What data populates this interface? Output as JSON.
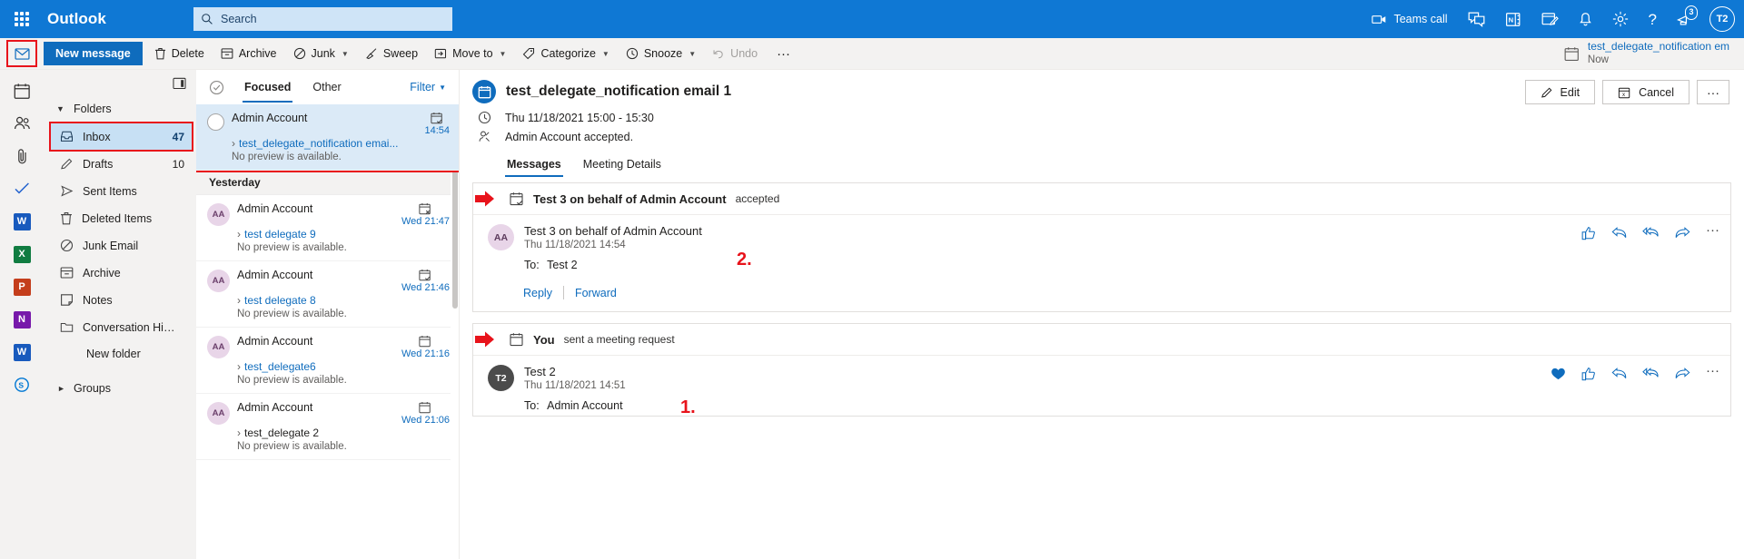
{
  "header": {
    "app_launcher": "waffle-icon",
    "brand": "Outlook",
    "search_placeholder": "Search",
    "teams_call": "Teams call",
    "notification_count": "3",
    "avatar_initials": "T2",
    "icons": [
      "camera-icon",
      "chat-icon",
      "onenote-icon",
      "todo-icon",
      "bell-icon",
      "gear-icon",
      "help-icon",
      "feedback-icon"
    ]
  },
  "toolbar": {
    "new_message": "New message",
    "items": [
      {
        "label": "Delete",
        "icon": "trash-icon",
        "chevron": false,
        "disabled": false
      },
      {
        "label": "Archive",
        "icon": "archive-icon",
        "chevron": false,
        "disabled": false
      },
      {
        "label": "Junk",
        "icon": "block-icon",
        "chevron": true,
        "disabled": false
      },
      {
        "label": "Sweep",
        "icon": "broom-icon",
        "chevron": false,
        "disabled": false
      },
      {
        "label": "Move to",
        "icon": "move-icon",
        "chevron": true,
        "disabled": false
      },
      {
        "label": "Categorize",
        "icon": "tag-icon",
        "chevron": true,
        "disabled": false
      },
      {
        "label": "Snooze",
        "icon": "clock-icon",
        "chevron": true,
        "disabled": false
      },
      {
        "label": "Undo",
        "icon": "undo-icon",
        "chevron": false,
        "disabled": true
      }
    ],
    "overflow": "···",
    "toast_title": "test_delegate_notification em",
    "toast_time": "Now"
  },
  "app_rail": [
    {
      "name": "mail-icon",
      "label": "",
      "color": "#0f6cbd"
    },
    {
      "name": "calendar-icon",
      "label": "",
      "color": "#0f6cbd"
    },
    {
      "name": "people-icon",
      "label": "",
      "color": "#0f6cbd"
    },
    {
      "name": "attachment-icon",
      "label": "",
      "color": "#0f6cbd"
    },
    {
      "name": "todo-icon",
      "label": "",
      "color": "#2564cf"
    },
    {
      "name": "word-icon",
      "label": "W",
      "color": "#185abd"
    },
    {
      "name": "excel-icon",
      "label": "X",
      "color": "#107c41"
    },
    {
      "name": "powerpoint-icon",
      "label": "P",
      "color": "#c43e1c"
    },
    {
      "name": "onenote-icon",
      "label": "N",
      "color": "#7719aa"
    },
    {
      "name": "word2-icon",
      "label": "W",
      "color": "#185abd"
    },
    {
      "name": "skype-icon",
      "label": "S",
      "color": "#0078d4"
    }
  ],
  "folders": {
    "group_label": "Folders",
    "groups_label": "Groups",
    "new_folder": "New folder",
    "items": [
      {
        "label": "Inbox",
        "count": "47",
        "icon": "inbox-icon",
        "selected": true,
        "outlined": true
      },
      {
        "label": "Drafts",
        "count": "10",
        "icon": "pencil-icon",
        "selected": false,
        "outlined": false
      },
      {
        "label": "Sent Items",
        "count": "",
        "icon": "send-icon",
        "selected": false,
        "outlined": false
      },
      {
        "label": "Deleted Items",
        "count": "",
        "icon": "trash-icon",
        "selected": false,
        "outlined": false
      },
      {
        "label": "Junk Email",
        "count": "",
        "icon": "block-icon",
        "selected": false,
        "outlined": false
      },
      {
        "label": "Archive",
        "count": "",
        "icon": "archive-icon",
        "selected": false,
        "outlined": false
      },
      {
        "label": "Notes",
        "count": "",
        "icon": "note-icon",
        "selected": false,
        "outlined": false
      },
      {
        "label": "Conversation His...",
        "count": "",
        "icon": "folder-icon",
        "selected": false,
        "outlined": false
      }
    ]
  },
  "message_list": {
    "select_all_icon": "check-circle-icon",
    "tab_focused": "Focused",
    "tab_other": "Other",
    "filter": "Filter",
    "day_separator": "Yesterday",
    "items": [
      {
        "sender": "Admin Account",
        "subject": "test_delegate_notification emai...",
        "preview": "No preview is available.",
        "date": "14:54",
        "avatar": "",
        "selected": true,
        "icon": "calendar-accepted-icon",
        "subject_link": true
      },
      {
        "sender": "Admin Account",
        "subject": "test delegate 9",
        "preview": "No preview is available.",
        "date": "Wed 21:47",
        "avatar": "AA",
        "selected": false,
        "icon": "calendar-cancel-icon",
        "subject_link": true
      },
      {
        "sender": "Admin Account",
        "subject": "test delegate 8",
        "preview": "No preview is available.",
        "date": "Wed 21:46",
        "avatar": "AA",
        "selected": false,
        "icon": "calendar-accepted-icon",
        "subject_link": true
      },
      {
        "sender": "Admin Account",
        "subject": "test_delegate6",
        "preview": "No preview is available.",
        "date": "Wed 21:16",
        "avatar": "AA",
        "selected": false,
        "icon": "calendar-icon",
        "subject_link": true
      },
      {
        "sender": "Admin Account",
        "subject": "test_delegate 2",
        "preview": "No preview is available.",
        "date": "Wed 21:06",
        "avatar": "AA",
        "selected": false,
        "icon": "calendar-icon",
        "subject_link": false
      }
    ]
  },
  "reading_pane": {
    "title": "test_delegate_notification email 1",
    "when": "Thu 11/18/2021 15:00 - 15:30",
    "status": "Admin Account accepted.",
    "edit": "Edit",
    "cancel": "Cancel",
    "overflow": "···",
    "tab_messages": "Messages",
    "tab_meeting_details": "Meeting Details",
    "annotation_2": "2.",
    "annotation_1": "1.",
    "threads": [
      {
        "header_bold": "Test 3 on behalf of Admin Account",
        "header_rest": "accepted",
        "header_icon": "calendar-accepted-icon",
        "from": "Test 3 on behalf of Admin Account",
        "date": "Thu 11/18/2021 14:54",
        "to_label": "To:",
        "to_value": "Test 2",
        "avatar": "AA",
        "avatar_style": "av-aa",
        "reply": "Reply",
        "forward": "Forward",
        "has_reply_row": true,
        "has_reaction": false,
        "icons": [
          "like-icon",
          "reply-icon",
          "reply-all-icon",
          "forward-icon",
          "more-icon"
        ]
      },
      {
        "header_bold": "You",
        "header_rest": "sent a meeting request",
        "header_icon": "calendar-icon",
        "from": "Test 2",
        "date": "Thu 11/18/2021 14:51",
        "to_label": "To:",
        "to_value": "Admin Account",
        "avatar": "T2",
        "avatar_style": "av-t2",
        "reply": "",
        "forward": "",
        "has_reply_row": false,
        "has_reaction": true,
        "icons": [
          "reaction-icon",
          "like-icon",
          "reply-icon",
          "reply-all-icon",
          "forward-icon",
          "more-icon"
        ]
      }
    ]
  },
  "colors": {
    "brand_blue": "#0f78d4",
    "accent_blue": "#0f6cbd",
    "highlight_red": "#e8131b",
    "selected_row": "#dbeaf7",
    "pane_bg": "#f3f2f1"
  }
}
